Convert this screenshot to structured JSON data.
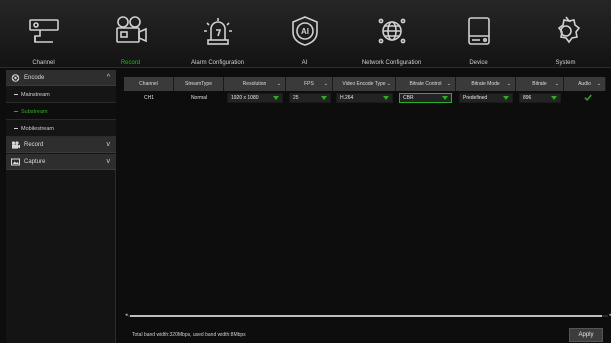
{
  "nav": {
    "items": [
      {
        "label": "Channel",
        "icon": "camera-icon"
      },
      {
        "label": "Record",
        "icon": "video-camera-icon"
      },
      {
        "label": "Alarm Configuration",
        "icon": "alarm-icon"
      },
      {
        "label": "AI",
        "icon": "ai-icon"
      },
      {
        "label": "Network Configuration",
        "icon": "globe-icon"
      },
      {
        "label": "Device",
        "icon": "hdd-icon"
      },
      {
        "label": "System",
        "icon": "gear-icon"
      }
    ],
    "active_index": 1
  },
  "sidebar": {
    "groups": [
      {
        "label": "Encode",
        "chevron": "^",
        "icon": "encode-icon",
        "expanded": true
      },
      {
        "label": "Record",
        "chevron": "v",
        "icon": "record-icon",
        "expanded": false
      },
      {
        "label": "Capture",
        "chevron": "v",
        "icon": "capture-icon",
        "expanded": false
      }
    ],
    "subitems": [
      {
        "label": "Mainstream",
        "active": false
      },
      {
        "label": "Substream",
        "active": true
      },
      {
        "label": "Mobilestream",
        "active": false
      }
    ]
  },
  "table": {
    "headers": [
      {
        "label": "Channel",
        "dropdown": false
      },
      {
        "label": "StreamType",
        "dropdown": false
      },
      {
        "label": "Resolution",
        "dropdown": true
      },
      {
        "label": "FPS",
        "dropdown": true
      },
      {
        "label": "Video Encode Type",
        "dropdown": true
      },
      {
        "label": "Bitrate Control",
        "dropdown": true
      },
      {
        "label": "Bitrate Mode",
        "dropdown": true
      },
      {
        "label": "Bitrate",
        "dropdown": true
      },
      {
        "label": "Audio",
        "dropdown": true
      }
    ],
    "rows": [
      {
        "channel": "CH1",
        "stream_type": "Normal",
        "resolution": "1920 x 1080",
        "fps": "25",
        "video_encode_type": "H.264",
        "bitrate_control": "CBR",
        "bitrate_mode": "Predefined",
        "bitrate": "896",
        "audio_checked": true
      }
    ]
  },
  "footer": {
    "bandwidth_text": "Total band width:320Mbps, used band width:8Mbps",
    "apply_label": "Apply"
  },
  "colors": {
    "accent": "#29b11f",
    "background": "#0d0d0d",
    "header_cell": "#3a3a3a"
  }
}
